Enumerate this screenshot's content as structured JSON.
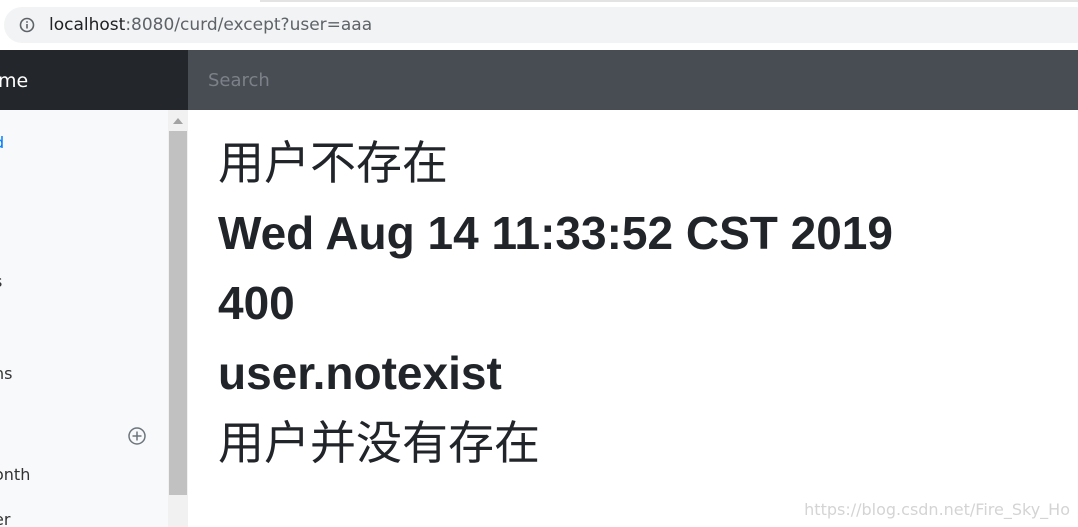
{
  "browser": {
    "url_host": "localhost",
    "url_rest": ":8080/curd/except?user=aaa"
  },
  "navbar": {
    "brand": "me",
    "search_placeholder": "Search"
  },
  "sidebar": {
    "items": [
      {
        "label": "d",
        "active": true
      },
      {
        "label": "s",
        "active": false
      },
      {
        "label": "ns",
        "active": false
      },
      {
        "label": "onth",
        "active": false
      },
      {
        "label": "er",
        "active": false
      }
    ]
  },
  "main": {
    "lines": [
      "用户不存在",
      "Wed Aug 14 11:33:52 CST 2019",
      "400",
      "user.notexist",
      "用户并没有存在"
    ],
    "watermark": "https://blog.csdn.net/Fire_Sky_Ho"
  },
  "colors": {
    "navbar": "#343a40",
    "brand_bg": "#23272b",
    "search_bg": "#484c53",
    "sidebar_bg": "#f8f9fa",
    "link_active": "#007bff"
  }
}
